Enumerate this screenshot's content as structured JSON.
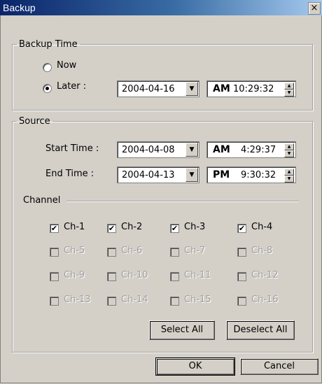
{
  "window": {
    "title": "Backup",
    "close_label": "×"
  },
  "backup_time": {
    "legend": "Backup Time",
    "now_label": "Now",
    "later_label": "Later :",
    "selected": "Later",
    "date": "2004-04-16",
    "ampm": "AM",
    "time": "10:29:32"
  },
  "source": {
    "legend": "Source",
    "start_label": "Start Time :",
    "start_date": "2004-04-08",
    "start_ampm": "AM",
    "start_time": "4:29:37",
    "end_label": "End Time :",
    "end_date": "2004-04-13",
    "end_ampm": "PM",
    "end_time": "9:30:32"
  },
  "channel": {
    "label": "Channel",
    "items": [
      {
        "label": "Ch-1",
        "checked": true,
        "enabled": true
      },
      {
        "label": "Ch-2",
        "checked": true,
        "enabled": true
      },
      {
        "label": "Ch-3",
        "checked": true,
        "enabled": true
      },
      {
        "label": "Ch-4",
        "checked": true,
        "enabled": true
      },
      {
        "label": "Ch-5",
        "checked": false,
        "enabled": false
      },
      {
        "label": "Ch-6",
        "checked": false,
        "enabled": false
      },
      {
        "label": "Ch-7",
        "checked": false,
        "enabled": false
      },
      {
        "label": "Ch-8",
        "checked": false,
        "enabled": false
      },
      {
        "label": "Ch-9",
        "checked": false,
        "enabled": false
      },
      {
        "label": "Ch-10",
        "checked": false,
        "enabled": false
      },
      {
        "label": "Ch-11",
        "checked": false,
        "enabled": false
      },
      {
        "label": "Ch-12",
        "checked": false,
        "enabled": false
      },
      {
        "label": "Ch-13",
        "checked": false,
        "enabled": false
      },
      {
        "label": "Ch-14",
        "checked": false,
        "enabled": false
      },
      {
        "label": "Ch-15",
        "checked": false,
        "enabled": false
      },
      {
        "label": "Ch-16",
        "checked": false,
        "enabled": false
      }
    ],
    "select_all": "Select All",
    "deselect_all": "Deselect All"
  },
  "buttons": {
    "ok": "OK",
    "cancel": "Cancel"
  },
  "icons": {
    "dropdown": "chevron-down-icon",
    "spin_up": "spin-up-icon",
    "spin_down": "spin-down-icon",
    "checkmark": "✔"
  }
}
